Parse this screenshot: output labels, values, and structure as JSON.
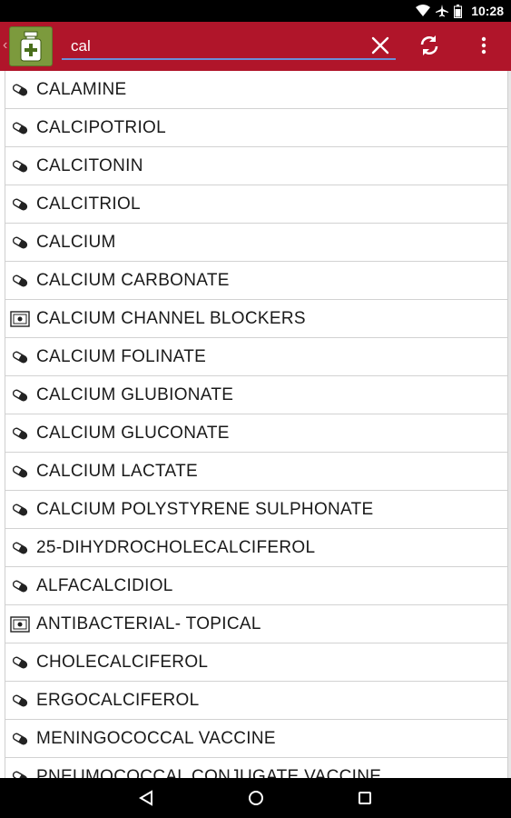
{
  "status_bar": {
    "time": "10:28",
    "icons": [
      "wifi-icon",
      "airplane-icon",
      "battery-icon"
    ]
  },
  "action_bar": {
    "app_icon": "medicine-bottle-icon",
    "search": {
      "value": "cal",
      "placeholder": ""
    },
    "clear_icon": "close-icon",
    "refresh_icon": "refresh-icon",
    "overflow_icon": "overflow-menu-icon",
    "background": "#b0152a"
  },
  "results": [
    {
      "label": "CALAMINE",
      "icon": "pill-icon"
    },
    {
      "label": "CALCIPOTRIOL",
      "icon": "pill-icon"
    },
    {
      "label": "CALCITONIN",
      "icon": "pill-icon"
    },
    {
      "label": "CALCITRIOL",
      "icon": "pill-icon"
    },
    {
      "label": "CALCIUM",
      "icon": "pill-icon"
    },
    {
      "label": "CALCIUM CARBONATE",
      "icon": "pill-icon"
    },
    {
      "label": "CALCIUM CHANNEL BLOCKERS",
      "icon": "drug-class-icon"
    },
    {
      "label": "CALCIUM FOLINATE",
      "icon": "pill-icon"
    },
    {
      "label": "CALCIUM GLUBIONATE",
      "icon": "pill-icon"
    },
    {
      "label": "CALCIUM GLUCONATE",
      "icon": "pill-icon"
    },
    {
      "label": "CALCIUM LACTATE",
      "icon": "pill-icon"
    },
    {
      "label": "CALCIUM POLYSTYRENE SULPHONATE",
      "icon": "pill-icon"
    },
    {
      "label": "25-DIHYDROCHOLECALCIFEROL",
      "icon": "pill-icon"
    },
    {
      "label": "ALFACALCIDIOL",
      "icon": "pill-icon"
    },
    {
      "label": "ANTIBACTERIAL- TOPICAL",
      "icon": "drug-class-icon"
    },
    {
      "label": "CHOLECALCIFEROL",
      "icon": "pill-icon"
    },
    {
      "label": "ERGOCALCIFEROL",
      "icon": "pill-icon"
    },
    {
      "label": "MENINGOCOCCAL VACCINE",
      "icon": "pill-icon"
    },
    {
      "label": "PNEUMOCOCCAL CONJUGATE VACCINE",
      "icon": "pill-icon"
    }
  ],
  "nav_bar": {
    "buttons": [
      "back-icon",
      "home-icon",
      "recents-icon"
    ]
  }
}
